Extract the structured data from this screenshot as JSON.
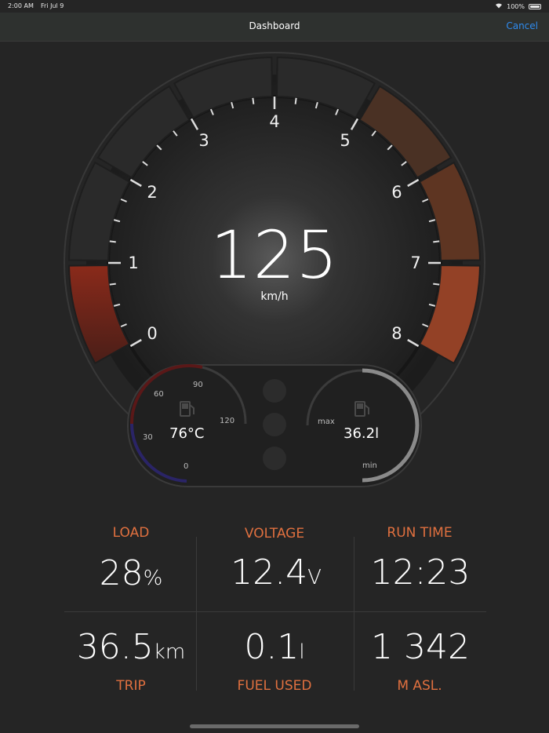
{
  "status_bar": {
    "time": "2:00 AM",
    "date": "Fri Jul 9",
    "battery": "100%"
  },
  "nav": {
    "title": "Dashboard",
    "cancel_label": "Cancel"
  },
  "speedometer": {
    "speed": "125",
    "unit": "km/h",
    "ticks": [
      "0",
      "1",
      "2",
      "3",
      "4",
      "5",
      "6",
      "7",
      "8"
    ]
  },
  "temperature": {
    "value": "76°C",
    "scale": [
      "0",
      "30",
      "60",
      "90",
      "120"
    ]
  },
  "fuel": {
    "value": "36.2l",
    "max_label": "max",
    "min_label": "min"
  },
  "stats": {
    "load": {
      "label": "LOAD",
      "value": "28",
      "unit": "%"
    },
    "voltage": {
      "label": "VOLTAGE",
      "value": "12.4",
      "unit": "V"
    },
    "run_time": {
      "label": "RUN TIME",
      "value": "12:23"
    },
    "trip": {
      "label": "TRIP",
      "value": "36.5",
      "unit": "km"
    },
    "fuel_used": {
      "label": "FUEL USED",
      "value": "0.1",
      "unit": "l"
    },
    "altitude": {
      "label": "M ASL.",
      "value": "1 342"
    }
  },
  "colors": {
    "accent": "#e0703f",
    "link": "#2f8cf0",
    "background": "#252525"
  }
}
